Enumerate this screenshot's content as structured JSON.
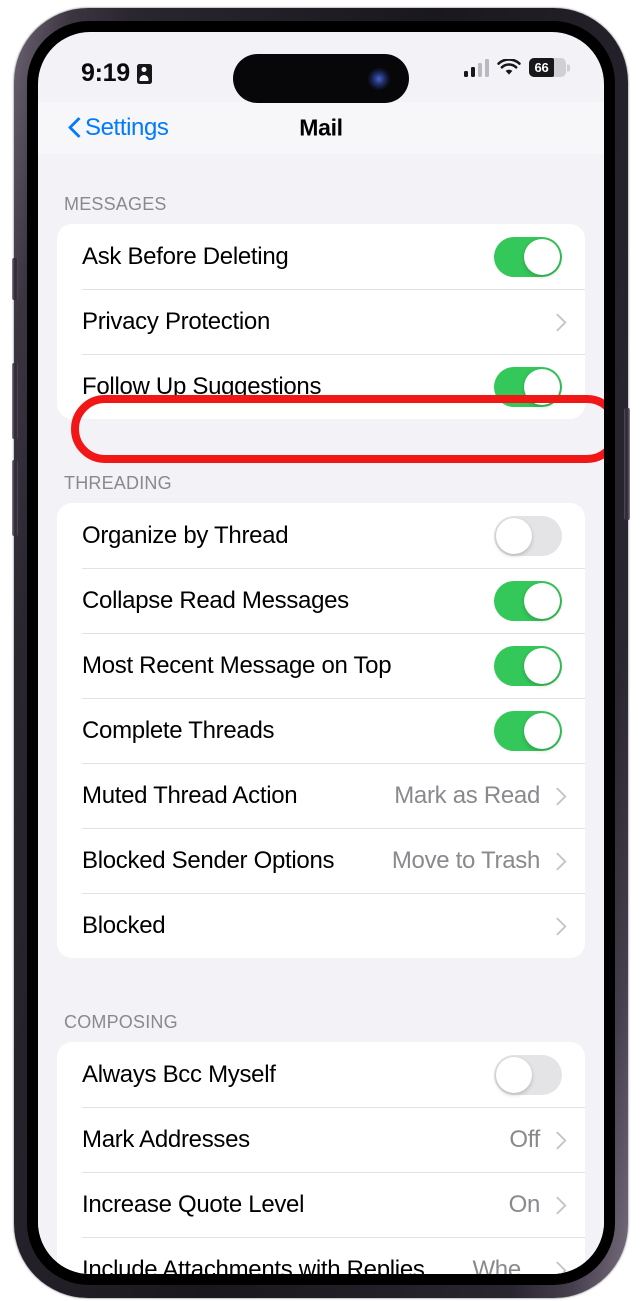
{
  "status_bar": {
    "time": "9:19",
    "location_icon": "location-badge-icon",
    "cellular_icon": "cellular-signal-icon",
    "wifi_icon": "wifi-icon",
    "battery_level": "66",
    "battery_icon": "battery-icon"
  },
  "nav": {
    "back_label": "Settings",
    "back_icon": "chevron-left-icon",
    "title": "Mail"
  },
  "colors": {
    "accent_blue": "#007aff",
    "toggle_on_green": "#34c759",
    "toggle_off_gray": "#e4e4e6",
    "highlight_red": "#f21717",
    "screen_background": "#f2f2f7",
    "group_background": "#ffffff",
    "secondary_text": "#8a8a8e"
  },
  "sections": [
    {
      "header": "MESSAGES",
      "rows": [
        {
          "label": "Ask Before Deleting",
          "type": "toggle",
          "state": "on"
        },
        {
          "label": "Privacy Protection",
          "type": "disclosure",
          "value": ""
        },
        {
          "label": "Follow Up Suggestions",
          "type": "toggle",
          "state": "on"
        }
      ]
    },
    {
      "header": "THREADING",
      "rows": [
        {
          "label": "Organize by Thread",
          "type": "toggle",
          "state": "off",
          "highlighted": true
        },
        {
          "label": "Collapse Read Messages",
          "type": "toggle",
          "state": "on"
        },
        {
          "label": "Most Recent Message on Top",
          "type": "toggle",
          "state": "on"
        },
        {
          "label": "Complete Threads",
          "type": "toggle",
          "state": "on"
        },
        {
          "label": "Muted Thread Action",
          "type": "disclosure",
          "value": "Mark as Read"
        },
        {
          "label": "Blocked Sender Options",
          "type": "disclosure",
          "value": "Move to Trash"
        },
        {
          "label": "Blocked",
          "type": "disclosure",
          "value": ""
        }
      ]
    },
    {
      "header": "COMPOSING",
      "rows": [
        {
          "label": "Always Bcc Myself",
          "type": "toggle",
          "state": "off"
        },
        {
          "label": "Mark Addresses",
          "type": "disclosure",
          "value": "Off"
        },
        {
          "label": "Increase Quote Level",
          "type": "disclosure",
          "value": "On"
        },
        {
          "label": "Include Attachments with Replies",
          "type": "disclosure",
          "value": "Whe..."
        }
      ]
    }
  ]
}
